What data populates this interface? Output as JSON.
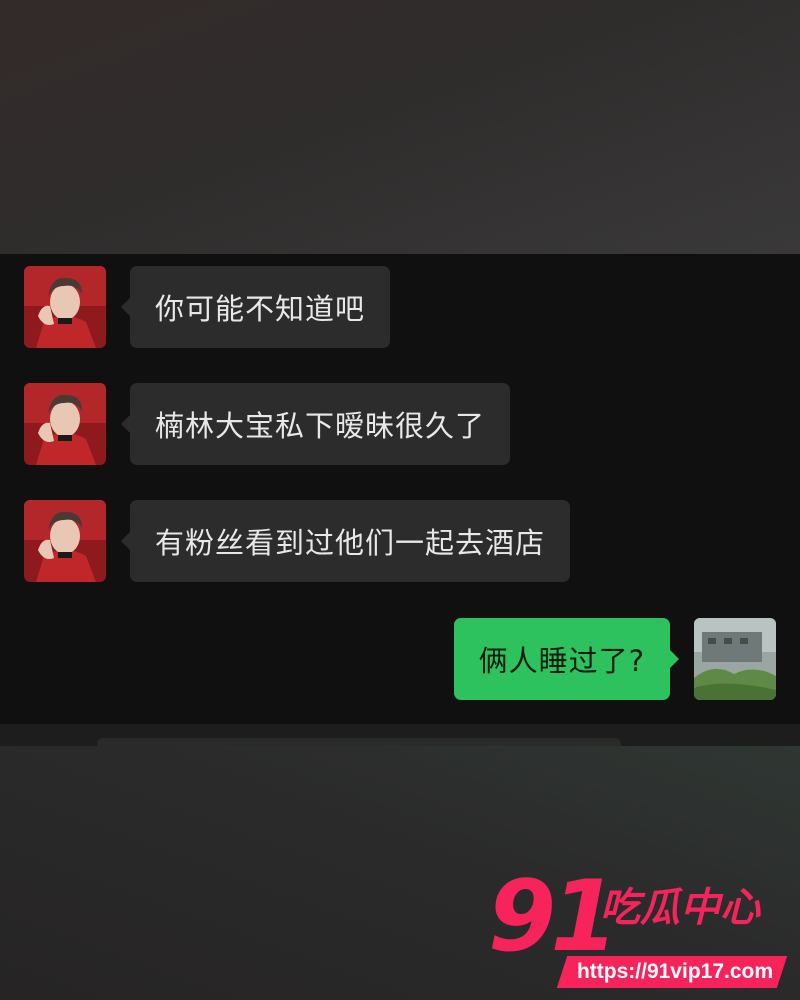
{
  "messages": [
    {
      "direction": "incoming",
      "text": "你可能不知道吧"
    },
    {
      "direction": "incoming",
      "text": "楠林大宝私下暧昧很久了"
    },
    {
      "direction": "incoming",
      "text": "有粉丝看到过他们一起去酒店"
    },
    {
      "direction": "outgoing",
      "text": "俩人睡过了?"
    }
  ],
  "watermark": {
    "number": "91",
    "brand": "吃瓜中心",
    "url": "https://91vip17.com"
  },
  "colors": {
    "chat_background": "#101010",
    "incoming_bubble": "#2c2c2c",
    "outgoing_bubble": "#2ec25e",
    "watermark_pink": "#f7245c"
  }
}
